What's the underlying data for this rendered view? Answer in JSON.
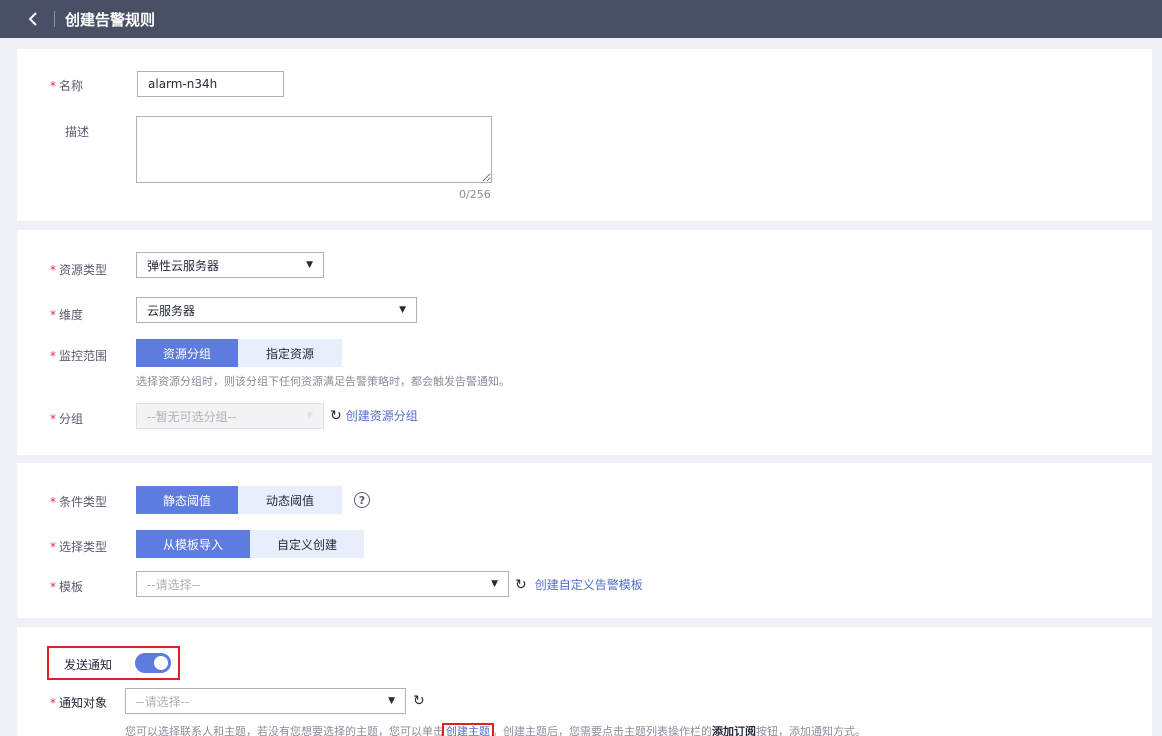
{
  "header": {
    "title": "创建告警规则"
  },
  "basic": {
    "name_label": "名称",
    "name_value": "alarm-n34h",
    "desc_label": "描述",
    "desc_counter": "0/256"
  },
  "resource": {
    "type_label": "资源类型",
    "type_value": "弹性云服务器",
    "dimension_label": "维度",
    "dimension_value": "云服务器",
    "scope_label": "监控范围",
    "scope_options": [
      "资源分组",
      "指定资源"
    ],
    "scope_hint": "选择资源分组时，则该分组下任何资源满足告警策略时，都会触发告警通知。",
    "group_label": "分组",
    "group_placeholder": "--暂无可选分组--",
    "group_create_link": "创建资源分组"
  },
  "condition": {
    "cond_type_label": "条件类型",
    "cond_type_options": [
      "静态阈值",
      "动态阈值"
    ],
    "select_type_label": "选择类型",
    "select_type_options": [
      "从模板导入",
      "自定义创建"
    ],
    "template_label": "模板",
    "template_placeholder": "--请选择--",
    "template_create_link": "创建自定义告警模板"
  },
  "notify": {
    "send_label": "发送通知",
    "send_enabled": true,
    "target_label": "通知对象",
    "target_placeholder": "--请选择--",
    "hint_prefix": "您可以选择联系人和主题，若没有您想要选择的主题，您可以单击",
    "hint_link": "创建主题",
    "hint_middle": "。创建主题后，您需要点击主题列表操作栏的",
    "hint_bold": "添加订阅",
    "hint_suffix": "按钮，添加通知方式。"
  },
  "colors": {
    "topbar": "#495066",
    "accent": "#5e7ce0",
    "required": "#e5303f",
    "highlight": "#e02020"
  }
}
